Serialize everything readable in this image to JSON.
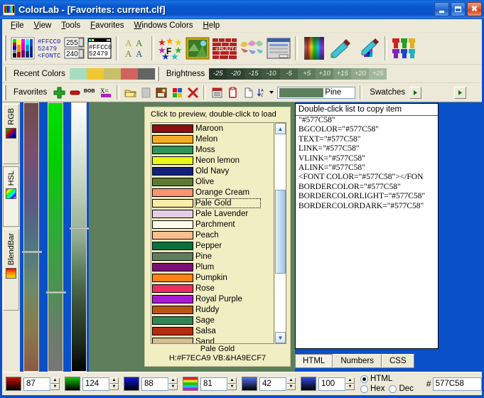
{
  "window": {
    "title": "ColorLab - [Favorites: current.clf]",
    "minimize_label": "Minimize",
    "maximize_label": "Maximize",
    "close_label": "Close"
  },
  "menu": {
    "items": [
      "File",
      "View",
      "Tools",
      "Favorites",
      "Windows Colors",
      "Help"
    ]
  },
  "toolbar": {
    "buttons": [
      {
        "name": "color-picker-palette-icon",
        "tip": "Color palette"
      },
      {
        "name": "html-code-icon",
        "tip": "HTML code"
      },
      {
        "name": "rgb-spin-values-icon",
        "tip": "RGB values"
      },
      {
        "name": "code-window-icon",
        "tip": "Code window"
      },
      {
        "name": "font-samples-icon",
        "tip": "Font samples"
      },
      {
        "name": "star-palette-icon",
        "tip": "Star palette"
      },
      {
        "name": "image-frame-icon",
        "tip": "Image frame"
      },
      {
        "name": "body-brick-icon",
        "tip": "BODY tag"
      },
      {
        "name": "butterfly-palette-icon",
        "tip": "Butterfly palette"
      },
      {
        "name": "dialog-preview-icon",
        "tip": "Dialog preview"
      },
      {
        "name": "spectrum-icon",
        "tip": "Spectrum"
      },
      {
        "name": "eyedropper-icon",
        "tip": "Eyedropper"
      },
      {
        "name": "eyedropper-grid-icon",
        "tip": "Screen picker"
      },
      {
        "name": "color-blend-icon",
        "tip": "Blend colors"
      }
    ],
    "toolbar_values": {
      "top_spin": "255",
      "bottom_spin": "240",
      "hex_sample": "#FFCC00",
      "dec_sample": "52479",
      "font_tag": "<FONT CO"
    }
  },
  "recent_colors": {
    "label": "Recent Colors",
    "swatches": [
      "#a7dcc2",
      "#f0c832",
      "#c7c069",
      "#d1635f",
      "#646464"
    ]
  },
  "brightness": {
    "label": "Brightness",
    "steps": [
      "-25",
      "-20",
      "-15",
      "-10",
      "-5",
      "+5",
      "+10",
      "+15",
      "+20",
      "+25"
    ],
    "colors": [
      "#28382a",
      "#2e4430",
      "#384f38",
      "#425a41",
      "#4d664b",
      "#5f7a5d",
      "#6c8769",
      "#7f9a7b",
      "#90a98c",
      "#a2b89d"
    ]
  },
  "favorites_bar": {
    "label": "Favorites",
    "buttons": [
      {
        "name": "add-favorite-icon"
      },
      {
        "name": "remove-favorite-icon"
      },
      {
        "name": "bob-label-icon"
      },
      {
        "name": "rename-icon"
      },
      {
        "name": "open-folder-icon"
      },
      {
        "name": "blank-page-icon"
      },
      {
        "name": "save-file-icon"
      },
      {
        "name": "color-grid-icon"
      },
      {
        "name": "delete-x-icon"
      },
      {
        "name": "copy-list-icon"
      },
      {
        "name": "clipboard-icon"
      },
      {
        "name": "new-document-icon"
      },
      {
        "name": "sort-az-icon"
      },
      {
        "name": "sort-dropdown-arrow-icon"
      }
    ],
    "current_color_name": "Pine",
    "current_color_hex": "#5d7f5c",
    "swatches_label": "Swatches",
    "swatch_next_label": "▶",
    "scroll_next_label": "▶"
  },
  "side_tabs": [
    {
      "label": "RGB",
      "selected": false
    },
    {
      "label": "HSL",
      "selected": true
    },
    {
      "label": "BlendBar",
      "selected": false
    }
  ],
  "color_list": {
    "hint": "Click to preview, double-click to load",
    "selected": "Pale Gold",
    "footer_name": "Pale Gold",
    "footer_codes": "H:#F7ECA9 VB:&HA9ECF7",
    "items": [
      {
        "name": "Maroon",
        "color": "#8b0f12"
      },
      {
        "name": "Melon",
        "color": "#f5ab27"
      },
      {
        "name": "Moss",
        "color": "#2f9459"
      },
      {
        "name": "Neon lemon",
        "color": "#eaf914"
      },
      {
        "name": "Old Navy",
        "color": "#13217a"
      },
      {
        "name": "Olive",
        "color": "#5f7a31"
      },
      {
        "name": "Orange Cream",
        "color": "#fa9472"
      },
      {
        "name": "Pale Gold",
        "color": "#f7eca9"
      },
      {
        "name": "Pale Lavender",
        "color": "#e7cce8"
      },
      {
        "name": "Parchment",
        "color": "#fdfbea"
      },
      {
        "name": "Peach",
        "color": "#ffc08d"
      },
      {
        "name": "Pepper",
        "color": "#09713f"
      },
      {
        "name": "Pine",
        "color": "#5d7f5c"
      },
      {
        "name": "Plum",
        "color": "#7a0e76"
      },
      {
        "name": "Pumpkin",
        "color": "#ff8212"
      },
      {
        "name": "Rose",
        "color": "#ed2d62"
      },
      {
        "name": "Royal Purple",
        "color": "#aa1ad4"
      },
      {
        "name": "Ruddy",
        "color": "#ba5518"
      },
      {
        "name": "Sage",
        "color": "#2e8758"
      },
      {
        "name": "Salsa",
        "color": "#b52c10"
      },
      {
        "name": "Sand",
        "color": "#d5bd92"
      }
    ]
  },
  "html_panel": {
    "header": "Double-click list to copy item",
    "lines": [
      "\"#577C58\"",
      "BGCOLOR=\"#577C58\"",
      "TEXT=\"#577C58\"",
      "LINK=\"#577C58\"",
      "VLINK=\"#577C58\"",
      "ALINK=\"#577C58\"",
      "<FONT COLOR=\"#577C58\"></FON",
      "BORDERCOLOR=\"#577C58\"",
      "BORDERCOLORLIGHT=\"#577C58\"",
      "BORDERCOLORDARK=\"#577C58\""
    ],
    "tabs": [
      {
        "label": "HTML",
        "selected": true
      },
      {
        "label": "Numbers",
        "selected": false
      },
      {
        "label": "CSS",
        "selected": false
      }
    ]
  },
  "status_bar": {
    "fields": [
      {
        "name": "red-value",
        "value": "87",
        "swatch": "#c41200"
      },
      {
        "name": "green-value",
        "value": "124",
        "swatch": "#14c400"
      },
      {
        "name": "blue-value",
        "value": "88",
        "swatch": "#1018d8"
      },
      {
        "name": "hue-value",
        "value": "81",
        "swatch": "rainbow"
      },
      {
        "name": "saturation-value",
        "value": "42",
        "swatch": "#5070e8"
      },
      {
        "name": "luminance-value",
        "value": "100",
        "swatch": "#3048d8"
      }
    ],
    "format_options": [
      {
        "label": "HTML",
        "selected": true
      },
      {
        "label": "Hex",
        "selected": false
      },
      {
        "label": "Dec",
        "selected": false
      }
    ],
    "hash_label": "#",
    "hex_value": "577C58"
  },
  "colors": {
    "current": "#5d7f5c",
    "selected_swatch": "#f7eca9",
    "panel_bg": "#ece9d8",
    "list_bg": "#f2eec4",
    "desktop_blue": "#0a50c8"
  }
}
